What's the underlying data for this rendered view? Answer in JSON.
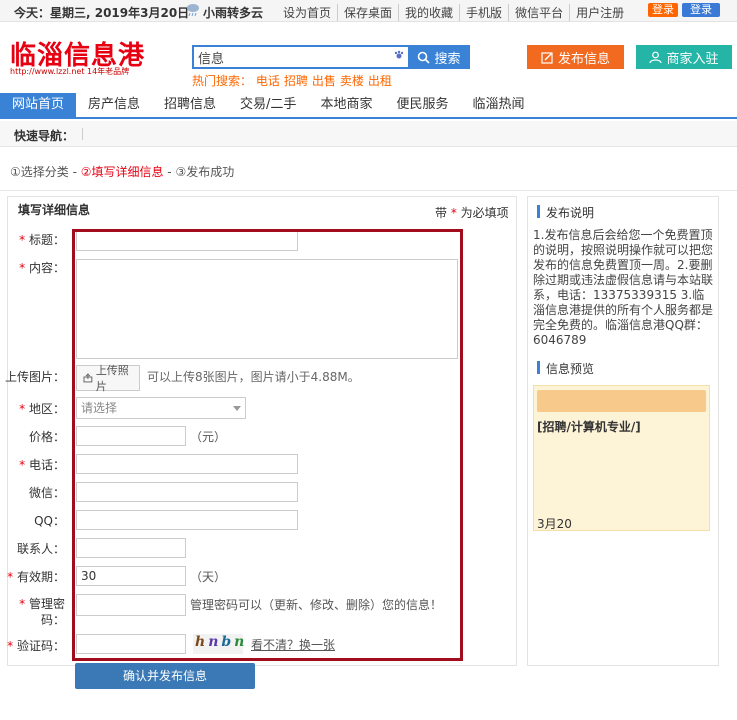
{
  "topbar": {
    "date": "今天：星期三, 2019年3月20日",
    "weather": "小雨转多云",
    "links": [
      "设为首页",
      "保存桌面",
      "我的收藏",
      "手机版",
      "微信平台",
      "用户注册"
    ],
    "login_a": "登录",
    "login_b": "登录"
  },
  "header": {
    "logo": "临淄信息港",
    "logo_sub": "http://www.lzzl.net 14年老品牌",
    "search_placeholder": "信息",
    "search_button": "搜索",
    "hot_label": "热门搜索：",
    "hot_words": [
      "电话",
      "招聘",
      "出售",
      "卖楼",
      "出租"
    ],
    "publish_button": "发布信息",
    "merchant_button": "商家入驻"
  },
  "nav": {
    "items": [
      "网站首页",
      "房产信息",
      "招聘信息",
      "交易/二手",
      "本地商家",
      "便民服务",
      "临淄热闻"
    ],
    "active_index": 0
  },
  "quicknav": {
    "label": "快速导航："
  },
  "steps": {
    "step1": "①选择分类 - ",
    "step2": "②填写详细信息",
    "step3": " - ③发布成功"
  },
  "form": {
    "title": "填写详细信息",
    "req_note_prefix": "带 ",
    "req_note_star": "*",
    "req_note_suffix": " 为必填项",
    "labels": {
      "title": "标题：",
      "content": "内容：",
      "upload": "上传图片：",
      "area": "地区：",
      "price": "价格：",
      "phone": "电话：",
      "wechat": "微信：",
      "qq": "QQ：",
      "contact": "联系人：",
      "validity": "有效期：",
      "password_a": "管理密",
      "password_b": "码：",
      "captcha": "验证码："
    },
    "upload_button": "上传照片",
    "upload_hint": "可以上传8张图片，图片请小于4.88M。",
    "area_placeholder": "请选择",
    "price_unit": "（元）",
    "validity_value": "30",
    "validity_unit": "（天）",
    "password_hint": "管理密码可以（更新、修改、删除）您的信息！",
    "captcha_chars": [
      "h",
      "n",
      "b",
      "n"
    ],
    "captcha_refresh": "看不清？换一张",
    "submit": "确认并发布信息"
  },
  "sidebar": {
    "publish_title": "发布说明",
    "publish_desc": "1.发布信息后会给您一个免费置顶的说明，按照说明操作就可以把您发布的信息免费置顶一周。2.要删除过期或违法虚假信息请与本站联系，电话：13375339315 3.临淄信息港提供的所有个人服务都是完全免费的。临淄信息港QQ群：6046789",
    "preview_title": "信息预览",
    "preview_text": "[招聘/计算机专业/]",
    "preview_date": "3月20"
  },
  "colors": {
    "accent": "#3a82d6",
    "logo": "#e60012",
    "publish": "#f26a20",
    "merchant": "#24b5a7",
    "highlight_box": "#a10d1c"
  }
}
